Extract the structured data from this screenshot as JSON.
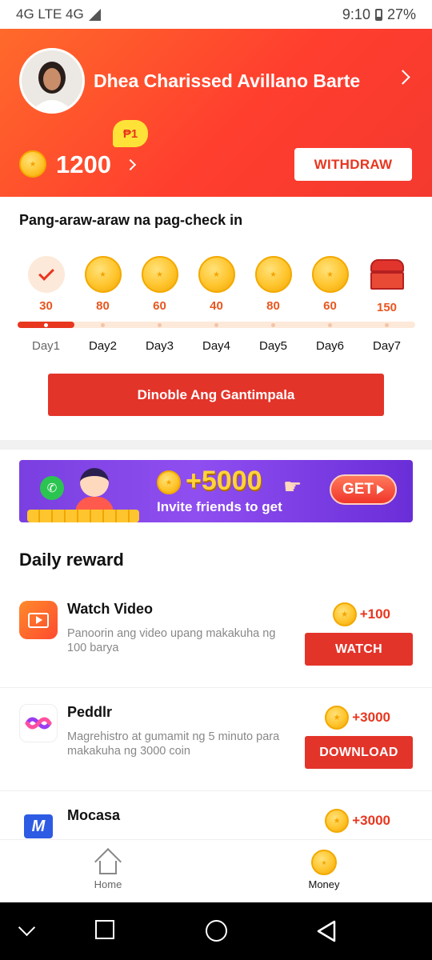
{
  "status_bar": {
    "left": "4G LTE 4G",
    "time": "9:10",
    "battery": "27%"
  },
  "profile": {
    "name": "Dhea Charissed Avillano Barte",
    "balance": "1200",
    "peso_badge": "₱1",
    "withdraw_label": "WITHDRAW"
  },
  "checkin": {
    "title": "Pang-araw-araw na pag-check in",
    "days": [
      {
        "label": "Day1",
        "amount": "30",
        "icon": "check-icon"
      },
      {
        "label": "Day2",
        "amount": "80",
        "icon": "coin-icon"
      },
      {
        "label": "Day3",
        "amount": "60",
        "icon": "coin-icon"
      },
      {
        "label": "Day4",
        "amount": "40",
        "icon": "coin-icon"
      },
      {
        "label": "Day5",
        "amount": "80",
        "icon": "coin-icon"
      },
      {
        "label": "Day6",
        "amount": "60",
        "icon": "coin-icon"
      },
      {
        "label": "Day7",
        "amount": "150",
        "icon": "treasure-chest-icon"
      }
    ],
    "progress_days_completed": 1,
    "claim_label": "Dinoble Ang Gantimpala"
  },
  "banner": {
    "amount": "+5000",
    "subtitle": "Invite friends to get",
    "cta": "GET"
  },
  "daily_reward": {
    "title": "Daily reward",
    "tasks": [
      {
        "title": "Watch Video",
        "desc": "Panoorin ang video upang makakuha ng 100 barya",
        "reward": "+100",
        "action": "WATCH",
        "icon": "video-icon"
      },
      {
        "title": "Peddlr",
        "desc": "Magrehistro at gumamit ng 5 minuto para makakuha ng 3000 coin",
        "reward": "+3000",
        "action": "DOWNLOAD",
        "icon": "peddlr-icon"
      },
      {
        "title": "Mocasa",
        "desc": "",
        "reward": "+3000",
        "action": "",
        "icon": "mocasa-icon"
      }
    ]
  },
  "nav": {
    "home": "Home",
    "money": "Money"
  },
  "colors": {
    "accent": "#e3342a",
    "header_start": "#ff6a2b",
    "header_end": "#f4392f",
    "coin": "#ffc52e"
  }
}
